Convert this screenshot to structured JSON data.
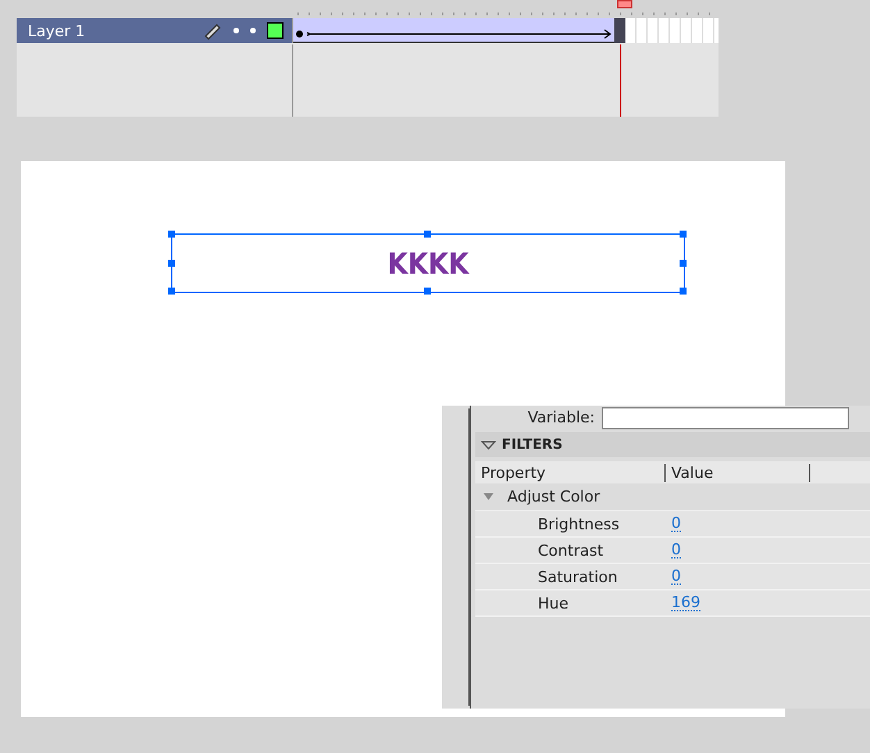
{
  "timeline": {
    "layers": [
      {
        "name": "Layer 1",
        "selected": true,
        "color": "#55ff55"
      }
    ]
  },
  "stage": {
    "text": "KKKK",
    "selected": true
  },
  "properties": {
    "variable_label": "Variable:",
    "filters": {
      "title": "FILTERS",
      "expanded": true,
      "columns": [
        "Property",
        "Value"
      ],
      "groups": [
        {
          "name": "Adjust Color",
          "expanded": true,
          "rows": [
            {
              "property": "Brightness",
              "value": "0"
            },
            {
              "property": "Contrast",
              "value": "0"
            },
            {
              "property": "Saturation",
              "value": "0"
            },
            {
              "property": "Hue",
              "value": "169"
            }
          ]
        }
      ]
    }
  }
}
